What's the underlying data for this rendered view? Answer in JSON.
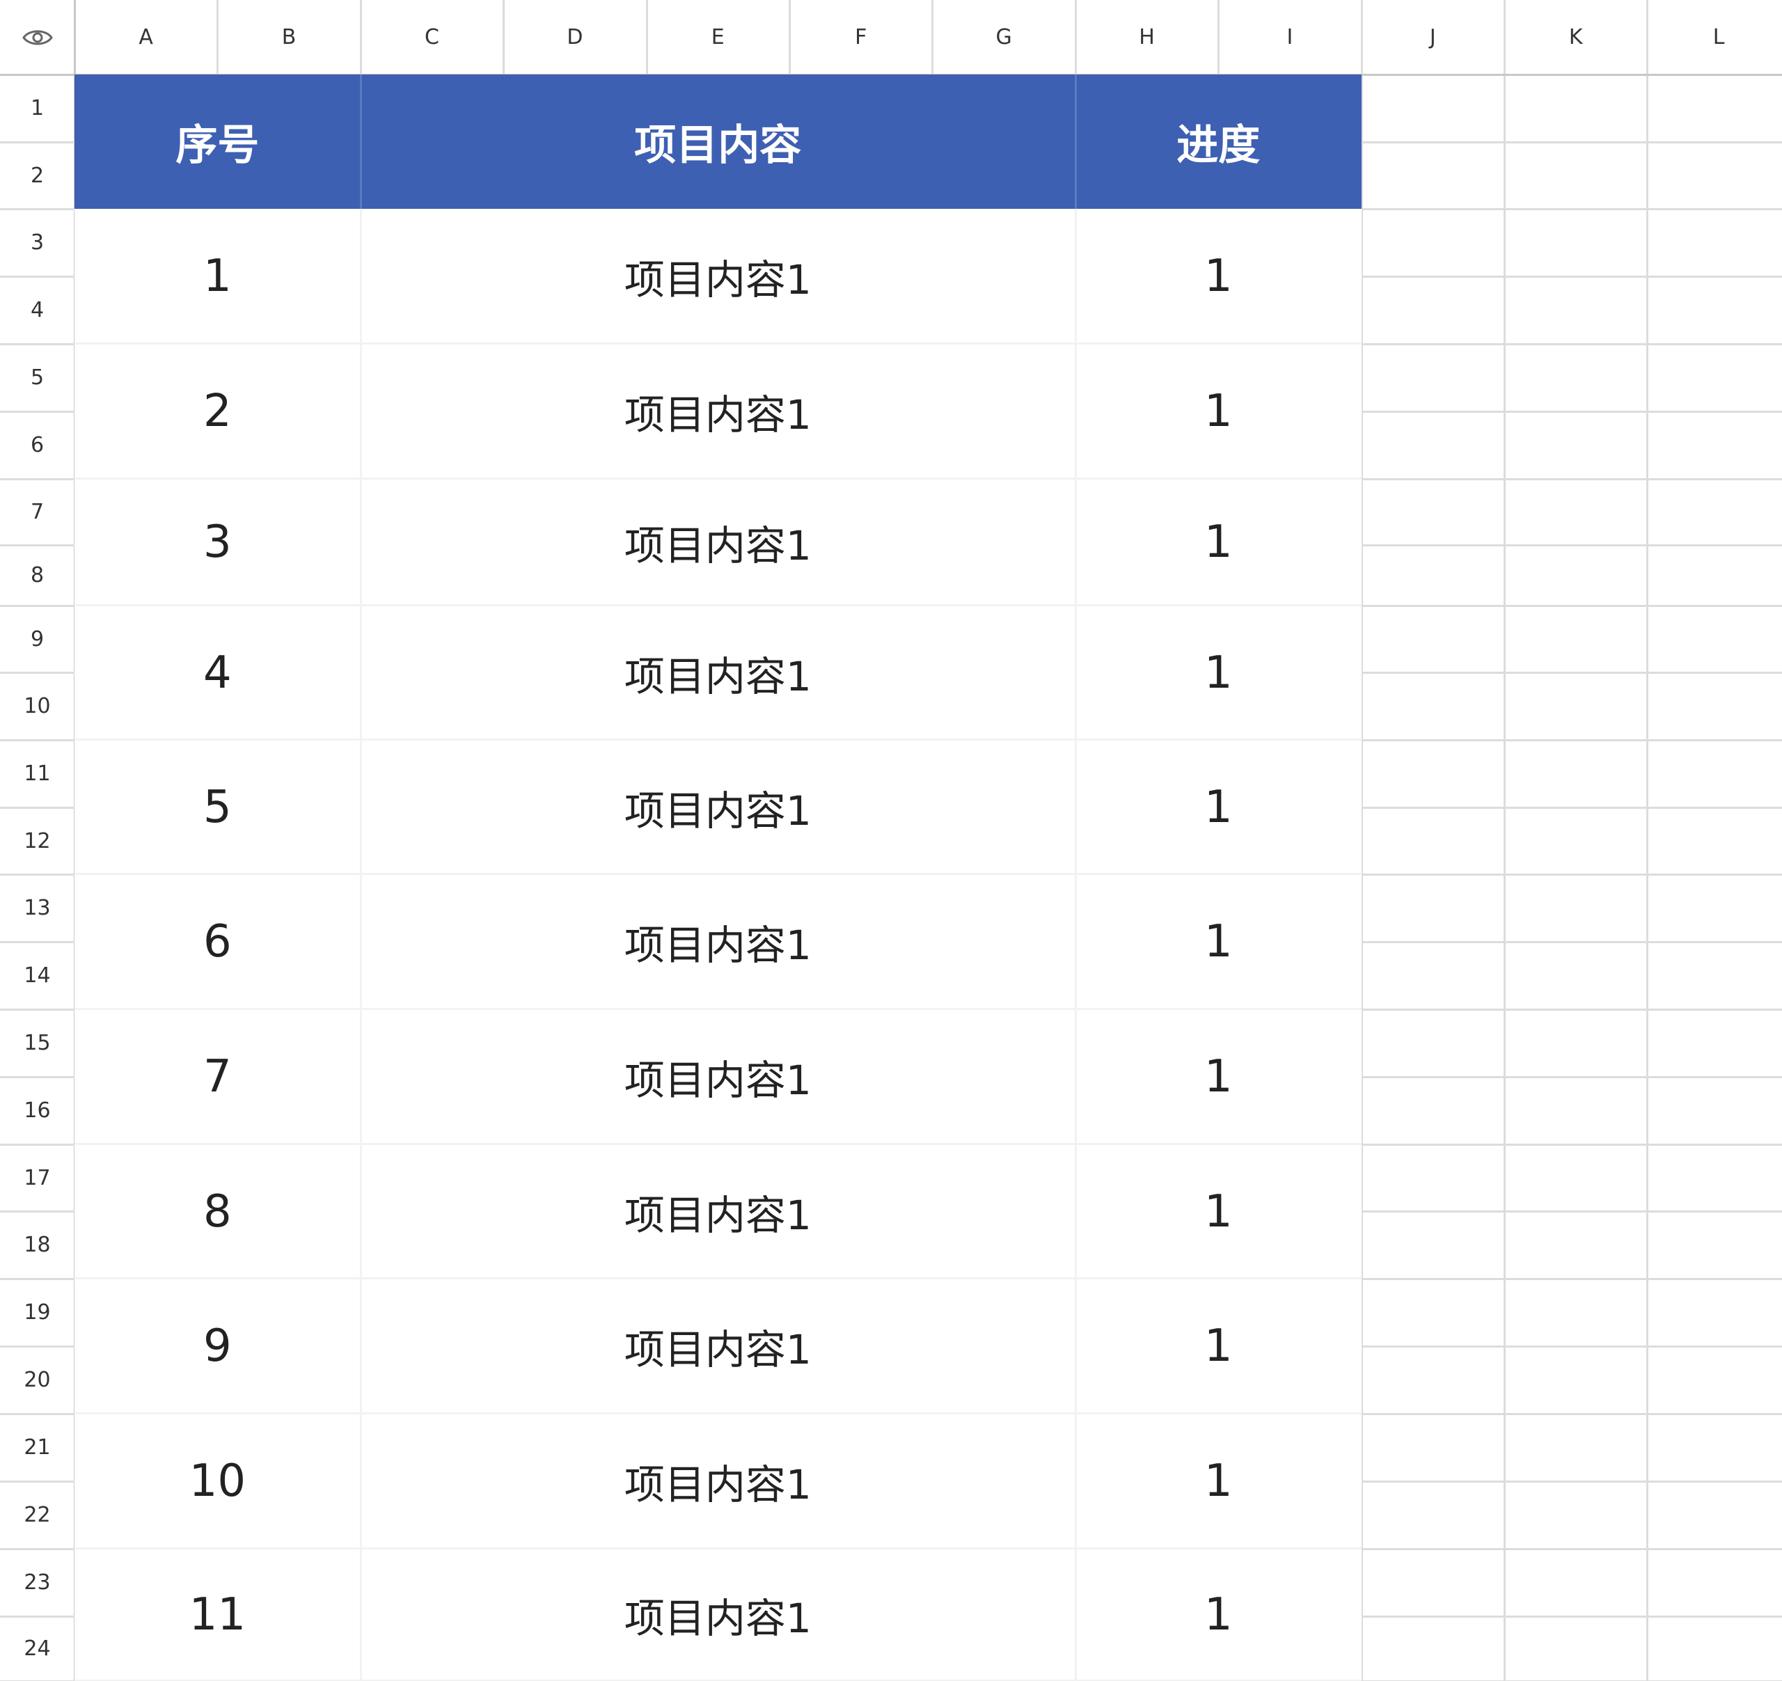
{
  "colors": {
    "header_bg": "#3e60b2",
    "header_text": "#ffffff",
    "grid_line": "#dcdcdc",
    "cell_text": "#222222"
  },
  "corner_icon": "eye-icon",
  "columns": [
    "A",
    "B",
    "C",
    "D",
    "E",
    "F",
    "G",
    "H",
    "I",
    "J",
    "K",
    "L"
  ],
  "rows": [
    "1",
    "2",
    "3",
    "4",
    "5",
    "6",
    "7",
    "8",
    "9",
    "10",
    "11",
    "12",
    "13",
    "14",
    "15",
    "16",
    "17",
    "18",
    "19",
    "20",
    "21",
    "22",
    "23",
    "24"
  ],
  "table": {
    "headers": [
      "序号",
      "项目内容",
      "进度"
    ],
    "rows": [
      {
        "seq": "1",
        "content": "项目内容1",
        "progress": "1"
      },
      {
        "seq": "2",
        "content": "项目内容1",
        "progress": "1"
      },
      {
        "seq": "3",
        "content": "项目内容1",
        "progress": "1"
      },
      {
        "seq": "4",
        "content": "项目内容1",
        "progress": "1"
      },
      {
        "seq": "5",
        "content": "项目内容1",
        "progress": "1"
      },
      {
        "seq": "6",
        "content": "项目内容1",
        "progress": "1"
      },
      {
        "seq": "7",
        "content": "项目内容1",
        "progress": "1"
      },
      {
        "seq": "8",
        "content": "项目内容1",
        "progress": "1"
      },
      {
        "seq": "9",
        "content": "项目内容1",
        "progress": "1"
      },
      {
        "seq": "10",
        "content": "项目内容1",
        "progress": "1"
      },
      {
        "seq": "11",
        "content": "项目内容1",
        "progress": "1"
      }
    ]
  }
}
